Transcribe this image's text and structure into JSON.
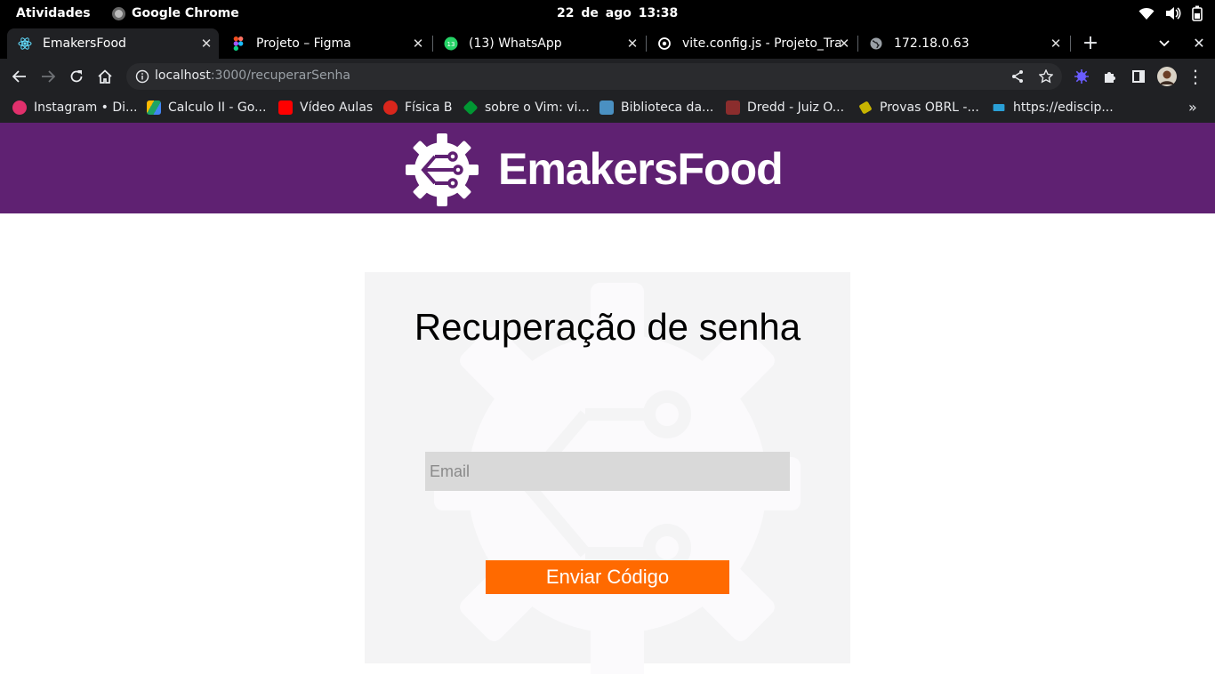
{
  "system_bar": {
    "activities": "Atividades",
    "app_name": "Google Chrome",
    "date": "22 de ago",
    "time": "13:38"
  },
  "tabs": [
    {
      "label": "EmakersFood",
      "icon": "react-icon",
      "active": true
    },
    {
      "label": "Projeto – Figma",
      "icon": "figma-icon",
      "active": false
    },
    {
      "label": "(13) WhatsApp",
      "icon": "whatsapp-icon",
      "active": false
    },
    {
      "label": "vite.config.js - Projeto_Tra",
      "icon": "github-icon",
      "active": false
    },
    {
      "label": "172.18.0.63",
      "icon": "globe-icon",
      "active": false
    }
  ],
  "address_bar": {
    "host": "localhost",
    "path": ":3000/recuperarSenha"
  },
  "bookmarks": [
    {
      "label": "Instagram • Di...",
      "icon": "instagram-icon",
      "color": "#e1306c"
    },
    {
      "label": "Calculo II - Go...",
      "icon": "google-drive-icon",
      "color": "#1fa463"
    },
    {
      "label": "Vídeo Aulas",
      "icon": "youtube-icon",
      "color": "#ff0000"
    },
    {
      "label": "Física B",
      "icon": "apple-icon",
      "color": "#d9261c"
    },
    {
      "label": "sobre o Vim: vi...",
      "icon": "vim-icon",
      "color": "#019733"
    },
    {
      "label": "Biblioteca da...",
      "icon": "library-icon",
      "color": "#4a90c2"
    },
    {
      "label": "Dredd - Juiz O...",
      "icon": "dredd-icon",
      "color": "#8b2d2d"
    },
    {
      "label": "Provas OBRL -...",
      "icon": "guitar-icon",
      "color": "#c8b400"
    },
    {
      "label": "https://ediscip...",
      "icon": "moodle-icon",
      "color": "#2a9fd6"
    }
  ],
  "header": {
    "brand": "EmakersFood",
    "background": "#5f2172"
  },
  "recovery_form": {
    "title": "Recuperação de senha",
    "email_placeholder": "Email",
    "email_value": "",
    "submit_label": "Enviar Código",
    "accent": "#ff6a00"
  }
}
